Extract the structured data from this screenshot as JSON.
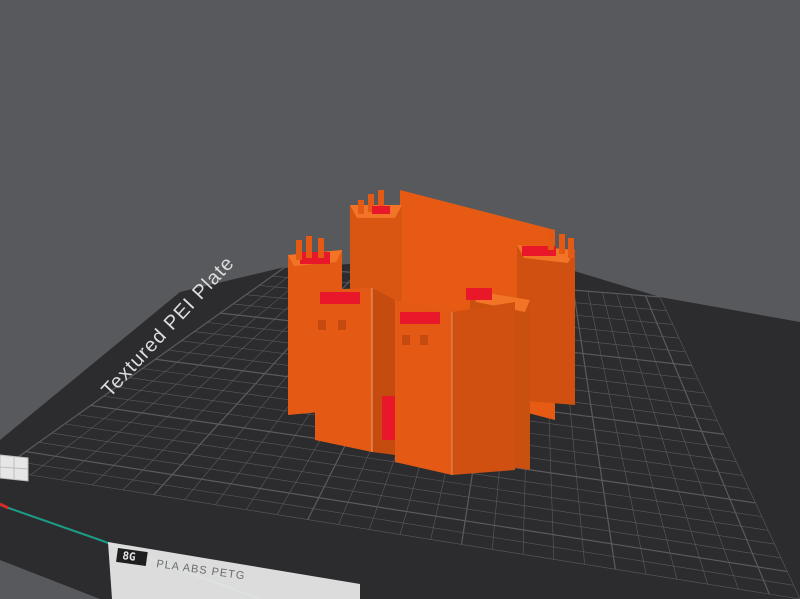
{
  "viewport": {
    "background_color": "#58595c"
  },
  "bed": {
    "plate_label": "Textured PEI Plate",
    "plate_label_partial_prefix": "Textured PEI Plate",
    "bed_surface_color": "#2c2c2e",
    "bed_grid_color": "#5b5b5f",
    "bed_edge_color": "#1e1e20",
    "front_edge_accent_color": "#1c9b86",
    "front_edge_red_marker_color": "#d62b2b",
    "badge_text": "PLA ABS PETG",
    "badge_logo": "8G"
  },
  "model": {
    "name": "castle",
    "primary_color": "#e45a14",
    "shadow_color": "#c54b0e",
    "highlight_color": "#f27426",
    "overhang_color": "#e8182a",
    "mortar_line_color": "#f5d9c8"
  }
}
